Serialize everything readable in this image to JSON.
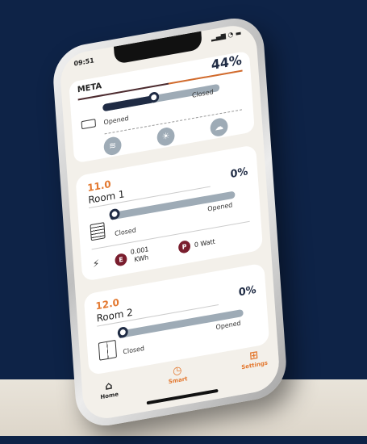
{
  "status": {
    "time": "09:51",
    "icons": "▂▄▆ ◔ ▬"
  },
  "meta": {
    "title": "META",
    "percent": "44%",
    "slider_fraction": 0.44,
    "opened_label": "Opened",
    "closed_label": "Closed",
    "buttons": [
      "wind-icon",
      "sun-icon",
      "rain-icon"
    ]
  },
  "rooms": [
    {
      "temp": "11.0",
      "name": "Room 1",
      "percent": "0%",
      "closed_label": "Closed",
      "opened_label": "Opened",
      "slider_fraction": 0.0
    },
    {
      "temp": "12.0",
      "name": "Room 2",
      "percent": "0%",
      "closed_label": "Closed",
      "opened_label": "Opened",
      "slider_fraction": 0.0
    }
  ],
  "energy": {
    "e_badge": "E",
    "e_value": "0.001",
    "e_unit": "KWh",
    "p_badge": "P",
    "p_value": "0 Watt"
  },
  "nav": {
    "home": "Home",
    "smart": "Smart",
    "settings": "Settings"
  },
  "colors": {
    "accent": "#e3782f",
    "dark": "#1f2b44",
    "badge": "#7a1e2e",
    "background": "#0e2347"
  }
}
